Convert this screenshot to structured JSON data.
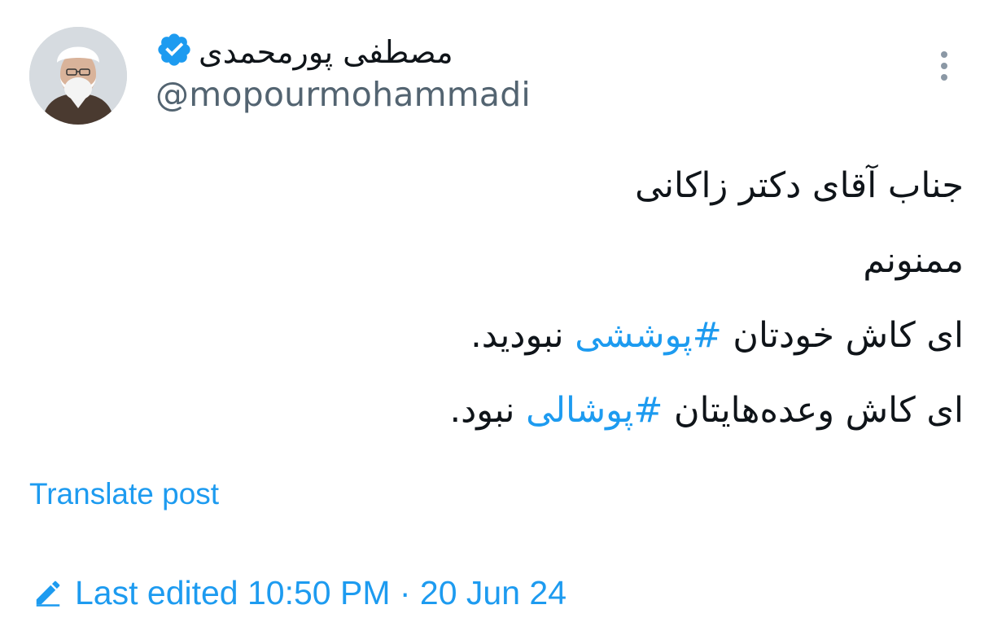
{
  "author": {
    "display_name": "مصطفی پورمحمدی",
    "handle": "@mopourmohammadi",
    "verified": true,
    "avatar_icon": "profile-photo"
  },
  "tweet": {
    "lines": [
      [
        {
          "text": "جناب آقای دکتر زاکانی",
          "hashtag": false
        }
      ],
      [
        {
          "text": "ممنونم",
          "hashtag": false
        }
      ],
      [
        {
          "text": "ای کاش خودتان ",
          "hashtag": false
        },
        {
          "text": "#پوششی",
          "hashtag": true
        },
        {
          "text": " نبودید.",
          "hashtag": false
        }
      ],
      [
        {
          "text": "ای کاش وعده‌هایتان ",
          "hashtag": false
        },
        {
          "text": "#پوشالی",
          "hashtag": true
        },
        {
          "text": " نبود.",
          "hashtag": false
        }
      ]
    ]
  },
  "actions": {
    "translate_label": "Translate post",
    "more_icon": "more-vertical-icon"
  },
  "edited": {
    "icon": "pencil-icon",
    "label": "Last edited 10:50 PM · 20 Jun 24"
  },
  "colors": {
    "link": "#1d9bf0",
    "text": "#0f1419",
    "secondary": "#536471"
  }
}
